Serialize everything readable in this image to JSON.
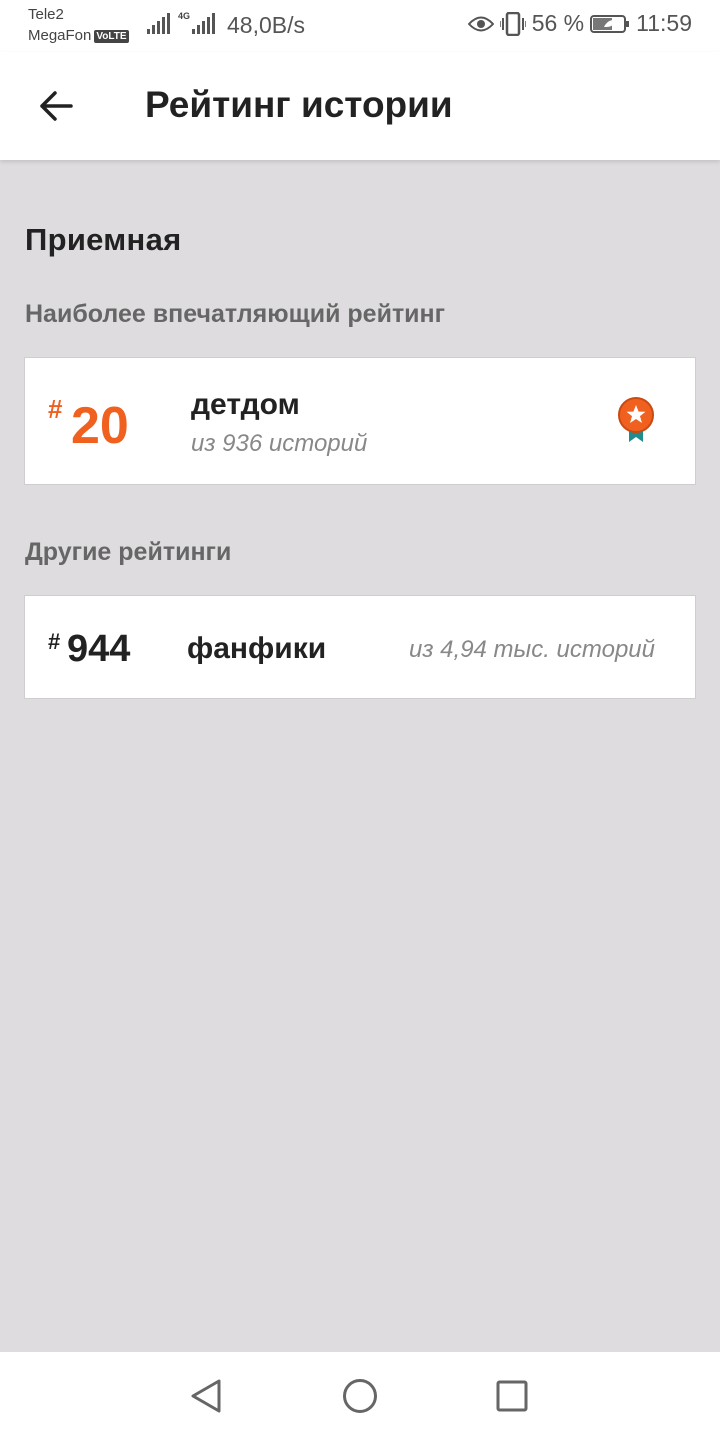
{
  "status_bar": {
    "carrier1": "Tele2",
    "carrier2": "MegaFon",
    "volte": "VoLTE",
    "network": "4G",
    "speed": "48,0B/s",
    "battery": "56 %",
    "time": "11:59",
    "icons": [
      "signal-icon",
      "eye-icon",
      "vibrate-icon",
      "battery-icon"
    ]
  },
  "app_bar": {
    "title": "Рейтинг истории",
    "back_icon": "arrow-left-icon"
  },
  "main": {
    "section_title": "Приемная",
    "top_heading": "Наиболее впечатляющий рейтинг",
    "top_card": {
      "hash": "#",
      "rank": "20",
      "name": "детдом",
      "subtitle": "из 936 историй",
      "badge_icon": "award-badge-icon"
    },
    "other_heading": "Другие рейтинги",
    "other_cards": [
      {
        "hash": "#",
        "rank": "944",
        "name": "фанфики",
        "subtitle": "из 4,94 тыс. историй"
      }
    ]
  },
  "colors": {
    "accent": "#f0601f",
    "badge_ribbon": "#1f8d8e",
    "background": "#dedcdf"
  },
  "nav_bar": {
    "icons": [
      "nav-back-icon",
      "nav-home-icon",
      "nav-recent-icon"
    ]
  }
}
